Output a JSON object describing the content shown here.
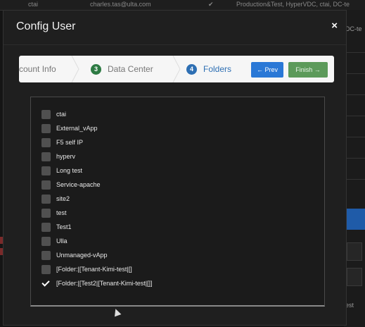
{
  "background": {
    "top_row": {
      "col1": "ctai",
      "col2": "charles.tas@ulta.com",
      "col4": "Production&Test, HyperVDC, ctai, DC-te"
    },
    "right_column": {
      "text_1": "DC-te",
      "text_2": "est"
    }
  },
  "modal": {
    "title": "Config User",
    "close_label": "×"
  },
  "wizard": {
    "steps": [
      {
        "number": "",
        "label": "count Info"
      },
      {
        "number": "3",
        "label": "Data Center"
      },
      {
        "number": "4",
        "label": "Folders"
      }
    ],
    "prev_label": "← Prev",
    "finish_label": "Finish →"
  },
  "folders": {
    "items": [
      {
        "label": "ctai",
        "checked": false
      },
      {
        "label": "External_vApp",
        "checked": false
      },
      {
        "label": "F5 self IP",
        "checked": false
      },
      {
        "label": "hyperv",
        "checked": false
      },
      {
        "label": "Long test",
        "checked": false
      },
      {
        "label": "Service-apache",
        "checked": false
      },
      {
        "label": "site2",
        "checked": false
      },
      {
        "label": "test",
        "checked": false
      },
      {
        "label": "Test1",
        "checked": false
      },
      {
        "label": "Ulla",
        "checked": false
      },
      {
        "label": "Unmanaged-vApp",
        "checked": false
      },
      {
        "label": "[Folder:|[Tenant-Kimi-test|[]",
        "checked": false
      },
      {
        "label": "[Folder:|[Test2|[Tenant-Kimi-test|[]]",
        "checked": true
      }
    ]
  },
  "colors": {
    "accent_blue": "#2a78d6",
    "finish_green": "#5c9a5a",
    "step_green": "#2d7a43",
    "step_blue": "#2e6fb3"
  }
}
